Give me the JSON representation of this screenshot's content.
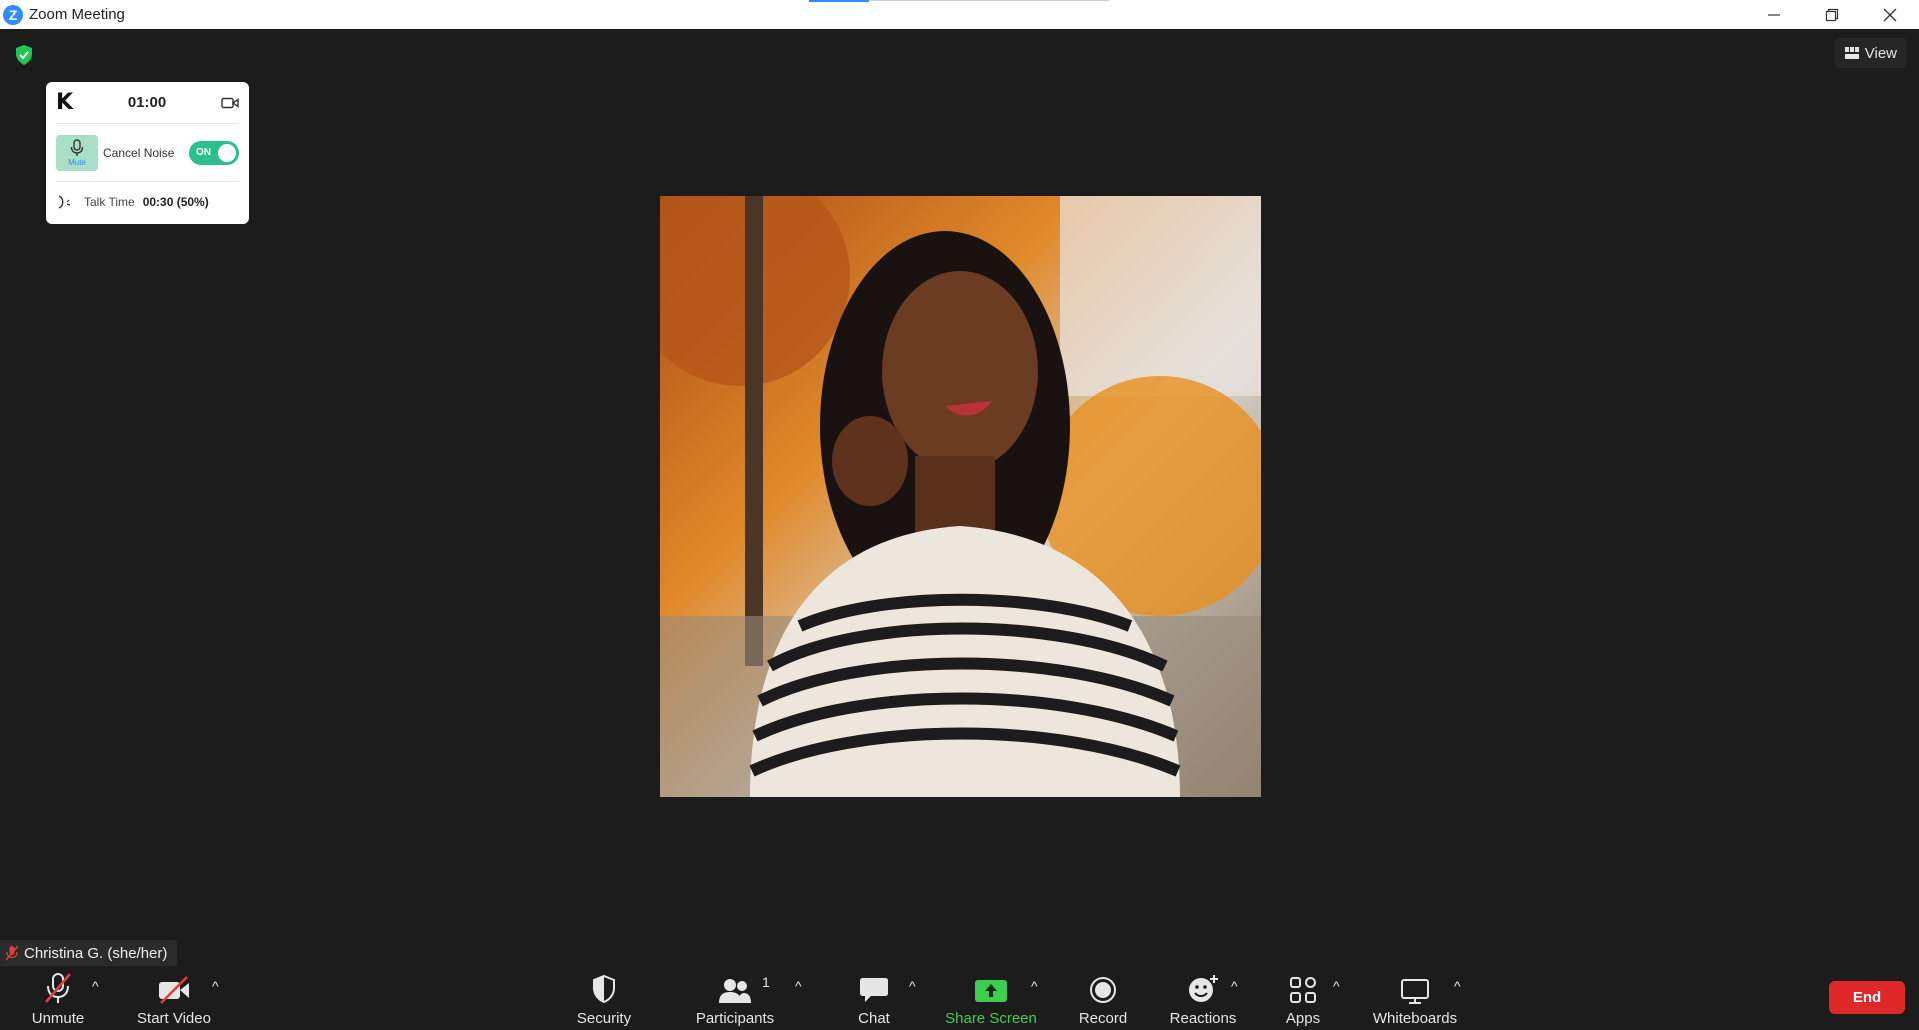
{
  "window": {
    "title": "Zoom Meeting",
    "controls": [
      "minimize-icon",
      "restore-icon",
      "close-icon"
    ]
  },
  "view_button": {
    "label": "View",
    "icon": "grid-icon"
  },
  "security_status": {
    "icon": "shield-check-icon",
    "color": "#23c552"
  },
  "widget": {
    "logo": "K",
    "timer": "01:00",
    "mute_label": "Mute",
    "cancel_noise_label": "Cancel Noise",
    "toggle_label": "ON",
    "toggle_state": true,
    "talk_time_label": "Talk Time",
    "talk_time_value": "00:30 (50%)"
  },
  "participant": {
    "name": "Christina G. (she/her)",
    "muted": true
  },
  "toolbar": {
    "unmute": "Unmute",
    "start_video": "Start Video",
    "security": "Security",
    "participants": "Participants",
    "participants_count": "1",
    "chat": "Chat",
    "share_screen": "Share Screen",
    "record": "Record",
    "reactions": "Reactions",
    "apps": "Apps",
    "whiteboards": "Whiteboards",
    "end": "End",
    "caret": "^"
  },
  "colors": {
    "background": "#1c1c1c",
    "accent": "#2d8cff",
    "share_green": "#3ccf4e",
    "end_red": "#e02828",
    "toggle_green": "#2bbf8e",
    "muted_red": "#e03e3e"
  }
}
